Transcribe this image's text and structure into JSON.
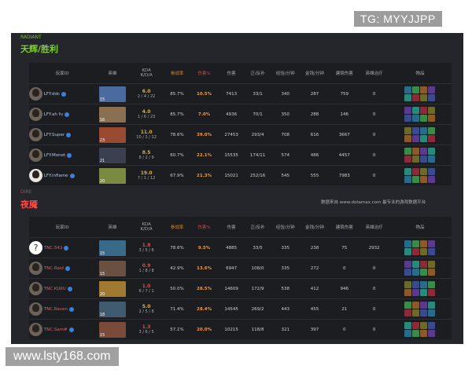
{
  "watermarks": {
    "tg": "TG: MYYJJPP",
    "url": "www.lsty168.com"
  },
  "radiant": {
    "label": "RADIANT",
    "title": "天辉/胜利",
    "players": [
      {
        "name": "LFY.ddc",
        "level": "15",
        "kda_ratio": "6.0",
        "kda": "2 / 4 / 22",
        "participation": "85.7%",
        "damage_pct": "10.5%",
        "damage": "7413",
        "lh_dn": "33/1",
        "xpm": "340",
        "gpm": "287",
        "building": "759",
        "heal": "0",
        "hero_color": "#4a6aa0",
        "avatar": "dark"
      },
      {
        "name": "LFY.ah fu",
        "level": "16",
        "kda_ratio": "4.0",
        "kda": "1 / 6 / 23",
        "participation": "85.7%",
        "damage_pct": "7.0%",
        "damage": "4936",
        "lh_dn": "70/1",
        "xpm": "350",
        "gpm": "288",
        "building": "146",
        "heal": "0",
        "hero_color": "#8a7050",
        "avatar": "dark"
      },
      {
        "name": "LFY.Super",
        "level": "23",
        "kda_ratio": "11.0",
        "kda": "10 / 2 / 12",
        "participation": "78.6%",
        "damage_pct": "39.0%",
        "damage": "27453",
        "lh_dn": "293/4",
        "xpm": "708",
        "gpm": "616",
        "building": "3667",
        "heal": "0",
        "hero_color": "#9a4a30",
        "avatar": "dark"
      },
      {
        "name": "LFY.Monet",
        "level": "21",
        "kda_ratio": "8.5",
        "kda": "8 / 2 / 9",
        "participation": "60.7%",
        "damage_pct": "22.1%",
        "damage": "15535",
        "lh_dn": "174/11",
        "xpm": "574",
        "gpm": "486",
        "building": "4457",
        "heal": "0",
        "hero_color": "#3a4050",
        "avatar": "dark"
      },
      {
        "name": "LFY.inflame",
        "level": "20",
        "kda_ratio": "19.0",
        "kda": "7 / 1 / 12",
        "participation": "67.9%",
        "damage_pct": "21.3%",
        "damage": "15021",
        "lh_dn": "252/16",
        "xpm": "545",
        "gpm": "555",
        "building": "7983",
        "heal": "0",
        "hero_color": "#7a8a40",
        "avatar": "light"
      }
    ]
  },
  "dire": {
    "label": "DIRE",
    "title": "夜魇",
    "source_note": "数据来自 www.dotamax.com 最专业的游戏数据平台",
    "players": [
      {
        "name": "TNC.543",
        "level": "15",
        "kda_ratio": "1.8",
        "kda": "3 / 5 / 6",
        "participation": "78.6%",
        "damage_pct": "9.5%",
        "damage": "4885",
        "lh_dn": "33/5",
        "xpm": "335",
        "gpm": "238",
        "building": "75",
        "heal": "2932",
        "hero_color": "#3a6a8a",
        "avatar": "unknown"
      },
      {
        "name": "TNC.Raid",
        "level": "15",
        "kda_ratio": "0.9",
        "kda": "1 / 8 / 8",
        "participation": "42.9%",
        "damage_pct": "13.6%",
        "damage": "6947",
        "lh_dn": "108/0",
        "xpm": "335",
        "gpm": "272",
        "building": "0",
        "heal": "0",
        "hero_color": "#6a5040",
        "avatar": "dark"
      },
      {
        "name": "TNC.KUKU",
        "level": "20",
        "kda_ratio": "1.0",
        "kda": "6 / 7 / 1",
        "participation": "50.0%",
        "damage_pct": "28.5%",
        "damage": "14609",
        "lh_dn": "172/9",
        "xpm": "538",
        "gpm": "412",
        "building": "946",
        "heal": "0",
        "hero_color": "#a07a30",
        "avatar": "dark"
      },
      {
        "name": "TNC.Raven",
        "level": "18",
        "kda_ratio": "5.0",
        "kda": "2 / 5 / 8",
        "participation": "71.4%",
        "damage_pct": "28.4%",
        "damage": "14545",
        "lh_dn": "269/2",
        "xpm": "443",
        "gpm": "455",
        "building": "21",
        "heal": "0",
        "hero_color": "#405a70",
        "avatar": "dark"
      },
      {
        "name": "TNC.Sam#",
        "level": "15",
        "kda_ratio": "1.3",
        "kda": "3 / 6 / 5",
        "participation": "57.1%",
        "damage_pct": "20.0%",
        "damage": "10215",
        "lh_dn": "118/8",
        "xpm": "321",
        "gpm": "397",
        "building": "0",
        "heal": "0",
        "hero_color": "#7a4a3a",
        "avatar": "dark"
      }
    ]
  },
  "columns": {
    "player_id": "玩家ID",
    "hero": "英雄",
    "kda": "KDA",
    "kda_sub": "K/D/A",
    "participation": "参战率",
    "damage_pct": "伤害%",
    "damage": "伤害",
    "lh_dn": "正/反补",
    "xpm": "经验/分钟",
    "gpm": "金钱/分钟",
    "building": "建筑伤害",
    "heal": "英雄治疗",
    "items": "物品"
  },
  "item_colors": [
    "#2a6a8a",
    "#3a8a4a",
    "#8a5a2a",
    "#5a3a8a",
    "#2a8a7a",
    "#8a2a3a",
    "#6a6a2a",
    "#3a4a8a"
  ]
}
